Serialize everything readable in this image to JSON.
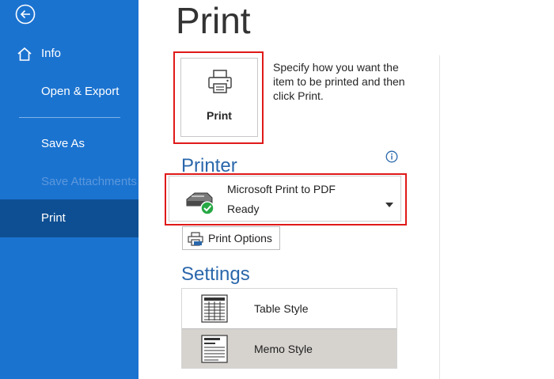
{
  "sidebar": {
    "back_icon": "back-arrow-icon",
    "items": [
      {
        "label": "Info",
        "icon": "home-icon"
      },
      {
        "label": "Open & Export"
      },
      {
        "label": "Save As"
      },
      {
        "label": "Save Attachments",
        "disabled": true
      },
      {
        "label": "Print",
        "selected": true
      }
    ]
  },
  "main": {
    "title": "Print",
    "print_button": {
      "label": "Print",
      "icon": "printer-icon"
    },
    "description": "Specify how you want the item to be printed and then click Print.",
    "printer": {
      "section_title": "Printer",
      "info_icon": "info-icon",
      "selected_printer": "Microsoft Print to PDF",
      "status": "Ready",
      "icon": "printer-ready-icon"
    },
    "print_options": {
      "label": "Print Options",
      "icon": "print-options-icon"
    },
    "settings": {
      "section_title": "Settings",
      "styles": [
        {
          "label": "Table Style",
          "icon": "table-style-icon",
          "selected": false
        },
        {
          "label": "Memo Style",
          "icon": "memo-style-icon",
          "selected": true
        }
      ]
    }
  },
  "colors": {
    "sidebar": "#1b73d0",
    "sidebar_selected": "#0e4f93",
    "accent_title": "#2a67ab",
    "highlight_outline": "#e01919",
    "status_green": "#27a844"
  }
}
